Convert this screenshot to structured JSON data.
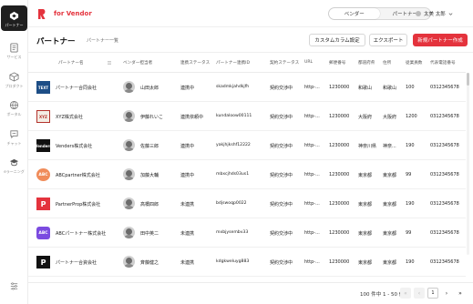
{
  "sidebar": {
    "items": [
      {
        "label": "パートナー",
        "icon": "partner-icon"
      },
      {
        "label": "サービス",
        "icon": "service-icon"
      },
      {
        "label": "プロダクト",
        "icon": "product-icon"
      },
      {
        "label": "ポータル",
        "icon": "portal-icon"
      },
      {
        "label": "チャット",
        "icon": "chat-icon"
      },
      {
        "label": "eラーニング",
        "icon": "elearning-icon"
      }
    ]
  },
  "header": {
    "brand": "for Vendor",
    "segment": {
      "left": "ベンダー",
      "right": "パートナー"
    },
    "user_name": "太美 太郎"
  },
  "page": {
    "title": "パートナー",
    "subtitle": "パートナー一覧",
    "buttons": {
      "custom_columns": "カスタムカラム設定",
      "export": "エクスポート",
      "new_partner": "新規パートナー作成"
    }
  },
  "table": {
    "headers": [
      "パートナー名",
      "ベンダー担当者",
      "連携ステータス",
      "パートナー連携ID",
      "契約ステータス",
      "URL",
      "郵便番号",
      "都道府県",
      "住所",
      "従業員数",
      "代表電話番号"
    ],
    "rows": [
      {
        "name": "パートナー合同会社",
        "logo": "TEXT",
        "logo_color": "#1d4e86",
        "vendor": "山田太郎",
        "status": "連携中",
        "link_id": "skadmkjahdkjfh",
        "contract": "契約交渉中",
        "url": "http-...",
        "zip": "1230000",
        "pref": "和歌山",
        "addr": "和歌山",
        "emp": "100",
        "tel": "0312345678"
      },
      {
        "name": "XYZ株式会社",
        "logo": "XYZ",
        "logo_color": "#f3ede4",
        "vendor": "伊藤れいこ",
        "status": "連携依頼中",
        "link_id": "kundaloow00111",
        "contract": "契約交渉中",
        "url": "http-...",
        "zip": "1230000",
        "pref": "大阪府",
        "addr": "大阪府",
        "emp": "1200",
        "tel": "0312345678"
      },
      {
        "name": "Venders株式会社",
        "logo": "Venders",
        "logo_color": "#111111",
        "vendor": "佐藤三郎",
        "status": "連携中",
        "link_id": "yakjhjkshf12222",
        "contract": "契約交渉中",
        "url": "http-...",
        "zip": "1230000",
        "pref": "神奈川県",
        "addr": "神奈...",
        "emp": "190",
        "tel": "0312345678"
      },
      {
        "name": "ABCpartner株式会社",
        "logo": "ABC",
        "logo_color": "#f08c5a",
        "vendor": "加藤大輔",
        "status": "連携中",
        "link_id": "mbxcjhds03us1",
        "contract": "契約交渉中",
        "url": "http-...",
        "zip": "1230000",
        "pref": "東京都",
        "addr": "東京都",
        "emp": "99",
        "tel": "0312345678"
      },
      {
        "name": "PartnerProp株式会社",
        "logo": "P",
        "logo_color": "#e4333d",
        "vendor": "高橋四郎",
        "status": "未連携",
        "link_id": "bdjswoqp0022",
        "contract": "契約交渉中",
        "url": "http-...",
        "zip": "1230000",
        "pref": "東京都",
        "addr": "東京都",
        "emp": "190",
        "tel": "0312345678"
      },
      {
        "name": "ABCパートナー株式会社",
        "logo": "ABC",
        "logo_color": "#7b4be0",
        "vendor": "田中英二",
        "status": "未連携",
        "link_id": "mxbjysembv33",
        "contract": "契約交渉中",
        "url": "http-...",
        "zip": "1230000",
        "pref": "東京都",
        "addr": "東京都",
        "emp": "99",
        "tel": "0312345678"
      },
      {
        "name": "パートナー合資会社",
        "logo": "P",
        "logo_color": "#111111",
        "vendor": "斉藤健之",
        "status": "未連携",
        "link_id": "kdgkweluyg883",
        "contract": "契約交渉中",
        "url": "http-...",
        "zip": "1230000",
        "pref": "東京都",
        "addr": "東京都",
        "emp": "190",
        "tel": "0312345678"
      }
    ]
  },
  "footer": {
    "count": "100 件中 1 - 50 件",
    "current_page": "1"
  },
  "colors": {
    "accent": "#e4333d",
    "sidebar_active": "#1f1f1f"
  }
}
